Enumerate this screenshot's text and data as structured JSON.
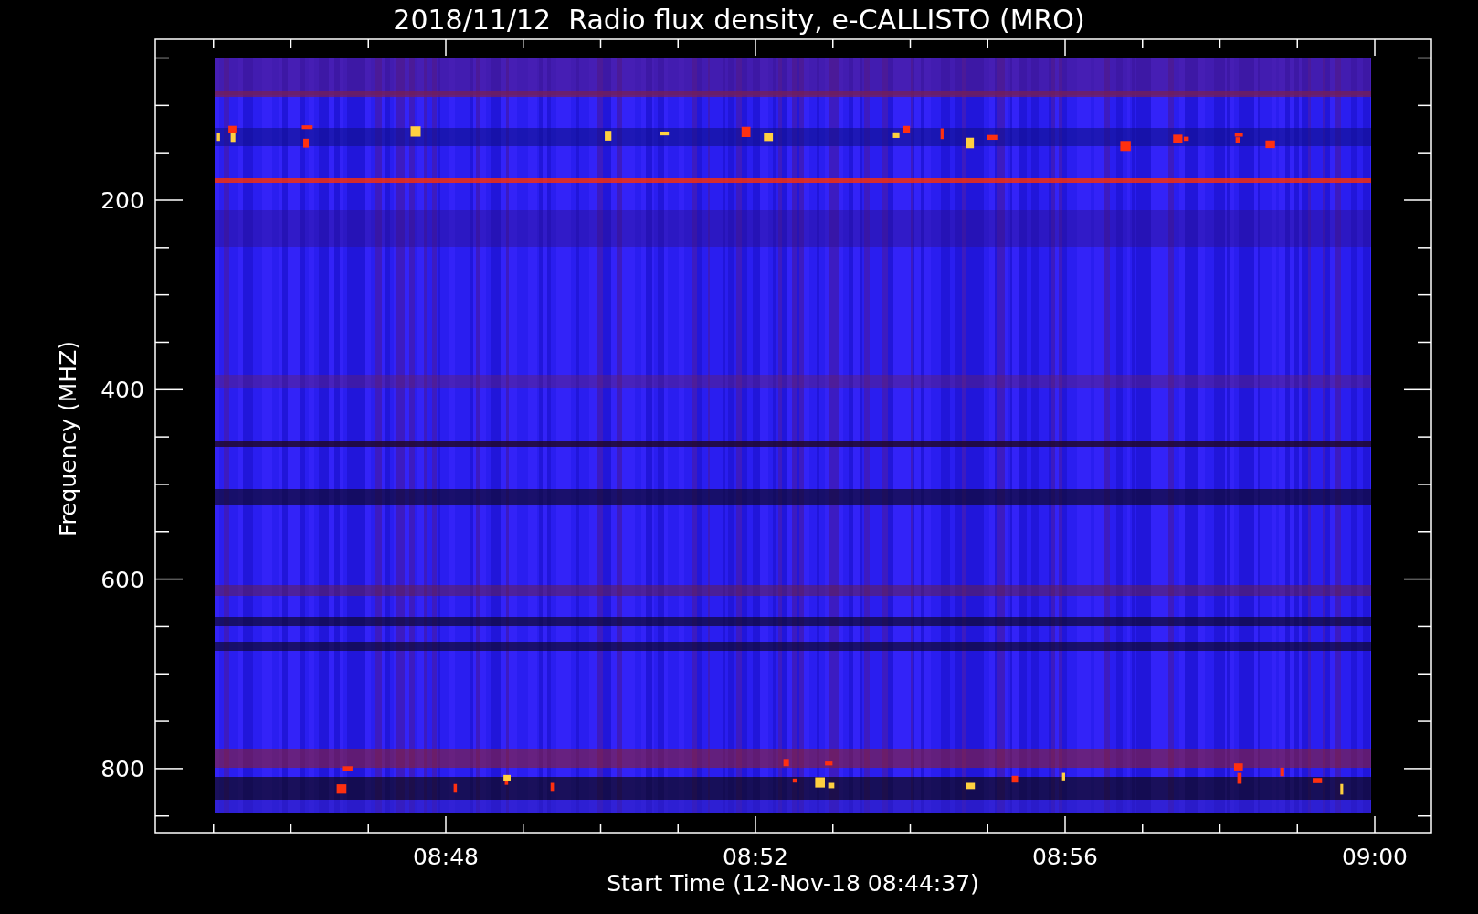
{
  "title": "2018/11/12  Radio flux density, e-CALLISTO (MRO)",
  "y_axis": {
    "label": "Frequency (MHZ)",
    "tick_labels": [
      "200",
      "400",
      "600",
      "800"
    ]
  },
  "x_axis": {
    "label": "Start Time (12-Nov-18 08:44:37)",
    "tick_labels": [
      "08:48",
      "08:52",
      "08:56",
      "09:00"
    ]
  }
}
